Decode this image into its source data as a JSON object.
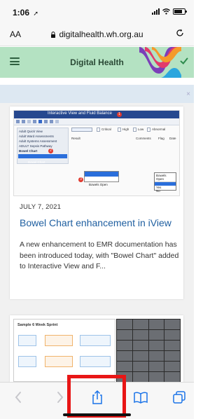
{
  "status_bar": {
    "time": "1:06",
    "location_glyph": "➚",
    "battery_level": 0.8
  },
  "browser": {
    "text_size_label": "AA",
    "url": "digitalhealth.wh.org.au",
    "lock_icon": "lock-icon",
    "reload_icon": "reload-icon"
  },
  "site": {
    "title": "Digital Health",
    "menu_icon": "hamburger-icon",
    "brand_colors": {
      "header_bg": "#b4e2c2",
      "accent_green": "#2e8b4e",
      "ribbon": [
        "#e23b6b",
        "#f59a2a",
        "#7b3fb8",
        "#2ba6de"
      ]
    }
  },
  "banner": {
    "close_glyph": "×"
  },
  "post": {
    "thumbnail": {
      "window_title": "Interactive View and Fluid Balance",
      "badge_1": "1",
      "badge_2": "2",
      "badge_3": "3",
      "nav_items": [
        "Adult Quick View",
        "Adult Ward Assessments",
        "Adult Systems Assessment",
        "ADULT Sepsis Pathway",
        "Bowel Chart"
      ],
      "selected_item": "Bowel Chart",
      "grid_labels": [
        "Critical",
        "High",
        "Low",
        "Abnormal"
      ],
      "row_label": "Result",
      "col_labels": [
        "Comments",
        "Flag",
        "Date"
      ],
      "dropdown_items": [
        "Bowel Chart",
        "Bowels Open"
      ],
      "popup_title": "Bowels Open",
      "popup_options": [
        "Yes",
        "No"
      ]
    },
    "date": "JULY 7, 2021",
    "title": "Bowel Chart enhancement in iView",
    "excerpt": "A new enhancement to EMR documentation has been introduced today, with \"Bowel Chart\" added to Interactive View and F..."
  },
  "post2": {
    "slide_title": "Sample 6 Week Sprint"
  },
  "toolbar": {
    "buttons": [
      {
        "name": "back",
        "icon": "chevron-left-icon",
        "enabled": false
      },
      {
        "name": "forward",
        "icon": "chevron-right-icon",
        "enabled": false
      },
      {
        "name": "share",
        "icon": "share-icon",
        "enabled": true
      },
      {
        "name": "bookmarks",
        "icon": "book-icon",
        "enabled": true
      },
      {
        "name": "tabs",
        "icon": "tabs-icon",
        "enabled": true
      }
    ],
    "highlight_color": "#e81616"
  }
}
